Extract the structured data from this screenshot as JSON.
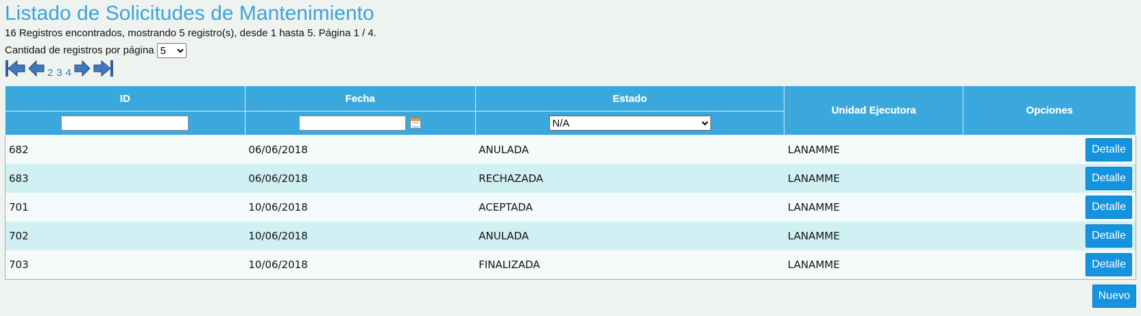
{
  "page": {
    "title": "Listado de Solicitudes de Mantenimiento",
    "summary": "16 Registros encontrados, mostrando 5 registro(s), desde 1 hasta 5. Página 1 / 4."
  },
  "pagination": {
    "per_page_label": "Cantidad de registros por página",
    "per_page_value": "5",
    "pages": [
      "2",
      "3",
      "4"
    ]
  },
  "table": {
    "headers": {
      "id": "ID",
      "fecha": "Fecha",
      "estado": "Estado",
      "unidad": "Unidad Ejecutora",
      "opciones": "Opciones"
    },
    "filters": {
      "id_value": "",
      "fecha_value": "",
      "estado_value": "N/A"
    },
    "rows": [
      {
        "id": "682",
        "fecha": "06/06/2018",
        "estado": "ANULADA",
        "unidad": "LANAMME",
        "action": "Detalle"
      },
      {
        "id": "683",
        "fecha": "06/06/2018",
        "estado": "RECHAZADA",
        "unidad": "LANAMME",
        "action": "Detalle"
      },
      {
        "id": "701",
        "fecha": "10/06/2018",
        "estado": "ACEPTADA",
        "unidad": "LANAMME",
        "action": "Detalle"
      },
      {
        "id": "702",
        "fecha": "10/06/2018",
        "estado": "ANULADA",
        "unidad": "LANAMME",
        "action": "Detalle"
      },
      {
        "id": "703",
        "fecha": "10/06/2018",
        "estado": "FINALIZADA",
        "unidad": "LANAMME",
        "action": "Detalle"
      }
    ]
  },
  "actions": {
    "new_label": "Nuevo"
  },
  "colors": {
    "accent": "#3aa3dc",
    "header_bg": "#3aa8dc",
    "button": "#1493df",
    "row_alt": "#d0f0f4"
  },
  "icons": [
    "first-page-icon",
    "prev-page-icon",
    "next-page-icon",
    "last-page-icon",
    "calendar-icon"
  ]
}
